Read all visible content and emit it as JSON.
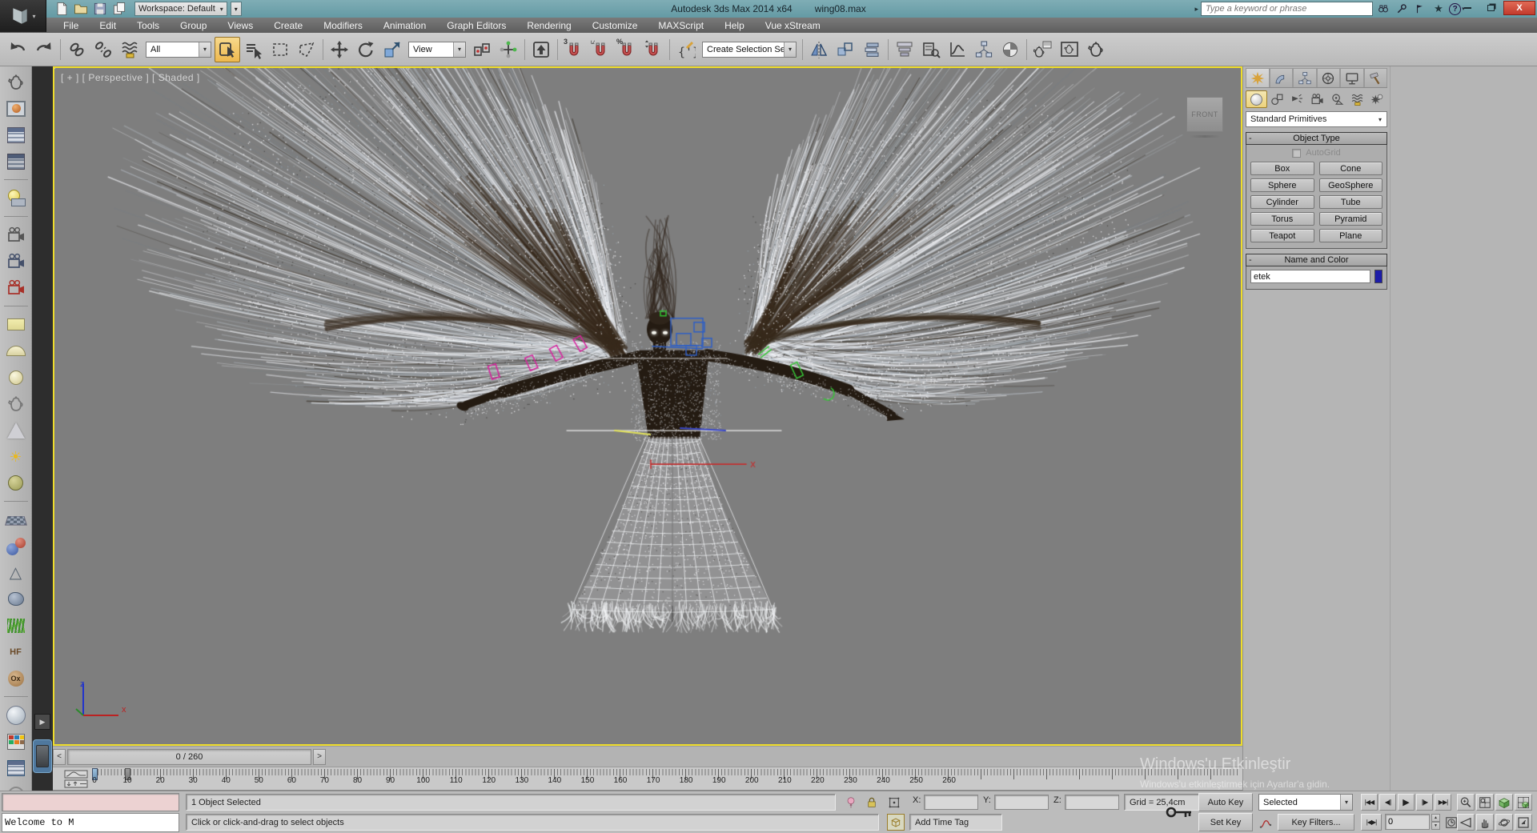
{
  "titlebar": {
    "workspace": "Workspace: Default",
    "title": "Autodesk 3ds Max  2014 x64",
    "document": "wing08.max",
    "search_placeholder": "Type a keyword or phrase",
    "star_glyph": "★",
    "help_glyph": "?"
  },
  "menu": {
    "items": [
      "File",
      "Edit",
      "Tools",
      "Group",
      "Views",
      "Create",
      "Modifiers",
      "Animation",
      "Graph Editors",
      "Rendering",
      "Customize",
      "MAXScript",
      "Help",
      "Vue xStream"
    ]
  },
  "toolbar": {
    "selection_filter": "All",
    "coordinate_system": "View",
    "named_selection_sets": "Create Selection Se",
    "snap_label": "3",
    "percent_label": "%",
    "dropdown_glyph": "▾"
  },
  "viewport": {
    "label": "[ + ] [ Perspective ] [ Shaded ]",
    "viewcube": "FRONT",
    "axis_x": "x",
    "axis_z": "z"
  },
  "command_panel": {
    "category": "Standard Primitives",
    "object_type_title": "Object Type",
    "autogrid_label": "AutoGrid",
    "object_buttons": [
      "Box",
      "Cone",
      "Sphere",
      "GeoSphere",
      "Cylinder",
      "Tube",
      "Torus",
      "Pyramid",
      "Teapot",
      "Plane"
    ],
    "name_color_title": "Name and Color",
    "name_value": "etek",
    "color_swatch": "#1c1ca8",
    "minus_glyph": "-"
  },
  "timeline": {
    "display": "0 / 260",
    "prev_glyph": "<",
    "next_glyph": ">",
    "labels": [
      "0",
      "10",
      "20",
      "30",
      "40",
      "50",
      "60",
      "70",
      "80",
      "90",
      "100",
      "110",
      "120",
      "130",
      "140",
      "150",
      "160",
      "170",
      "180",
      "190",
      "200",
      "210",
      "220",
      "230",
      "240",
      "250",
      "260"
    ]
  },
  "left_toolbar": {
    "sun_glyph": "☀",
    "pyramid_glyph": "△",
    "hf_label": "HF",
    "ox_label": "Ox",
    "help_glyph": "?",
    "play_glyph": "▶"
  },
  "status": {
    "selection": "1 Object Selected",
    "prompt": "Click or click-and-drag to select objects",
    "listener": "Welcome to M",
    "x_label": "X:",
    "y_label": "Y:",
    "z_label": "Z:",
    "grid_label": "Grid = 25,4cm",
    "add_time_tag": "Add Time Tag",
    "auto_key": "Auto Key",
    "set_key": "Set Key",
    "selected_dropdown": "Selected",
    "key_filters": "Key Filters...",
    "frame_value": "0",
    "transport": {
      "start": "|◀◀",
      "prev": "◀||",
      "play": "▶",
      "next": "||▶",
      "end": "▶▶|",
      "keymode": "|◀▶|"
    }
  },
  "watermark": {
    "line1": "Windows'u Etkinleştir",
    "line2": "Windows'u etkinleştirmek için Ayarlar'a gidin."
  }
}
